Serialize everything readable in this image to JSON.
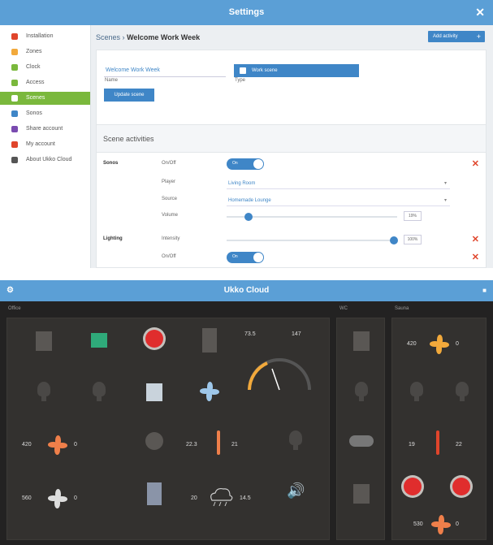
{
  "settings": {
    "title": "Settings",
    "sidebar": [
      {
        "label": "Installation",
        "color": "#e0452b"
      },
      {
        "label": "Zones",
        "color": "#f2a93b"
      },
      {
        "label": "Clock",
        "color": "#7ab83c"
      },
      {
        "label": "Access",
        "color": "#7ab83c"
      },
      {
        "label": "Scenes",
        "color": "#ffffff",
        "active": true
      },
      {
        "label": "Sonos",
        "color": "#3f86c7"
      },
      {
        "label": "Share account",
        "color": "#7a4bb0"
      },
      {
        "label": "My account",
        "color": "#e0452b"
      },
      {
        "label": "About Ukko Cloud",
        "color": "#555555"
      }
    ],
    "breadcrumb_parent": "Scenes",
    "breadcrumb_sep": "›",
    "breadcrumb_current": "Welcome Work Week",
    "add_activity_label": "Add activity",
    "name_label": "Name",
    "name_value": "Welcome Work Week",
    "type_label": "Type",
    "type_value": "Work scene",
    "update_label": "Update scene",
    "activities_heading": "Scene activities",
    "sonos_group": "Sonos",
    "onoff_key": "On/Off",
    "on_label": "On",
    "player_key": "Player",
    "player_value": "Living Room",
    "source_key": "Source",
    "source_value": "Homemade Lounge",
    "volume_key": "Volume",
    "volume_fraction": 0.13,
    "volume_value": "19%",
    "lighting_group": "Lighting",
    "intensity_key": "Intensity",
    "intensity_fraction": 0.98,
    "intensity_value": "100%"
  },
  "cloud": {
    "title": "Ukko Cloud",
    "panel_office": "Office",
    "panel_mid": "WC",
    "panel_right": "Sauna",
    "fan_values": [
      "420",
      "0",
      "420",
      "0",
      "560",
      "0",
      "530",
      "0"
    ],
    "gauge_values": [
      "73.5",
      "147"
    ],
    "temp_values": [
      "22.3",
      "21",
      "19",
      "22"
    ],
    "weather_values": [
      "20",
      "14.5"
    ]
  }
}
